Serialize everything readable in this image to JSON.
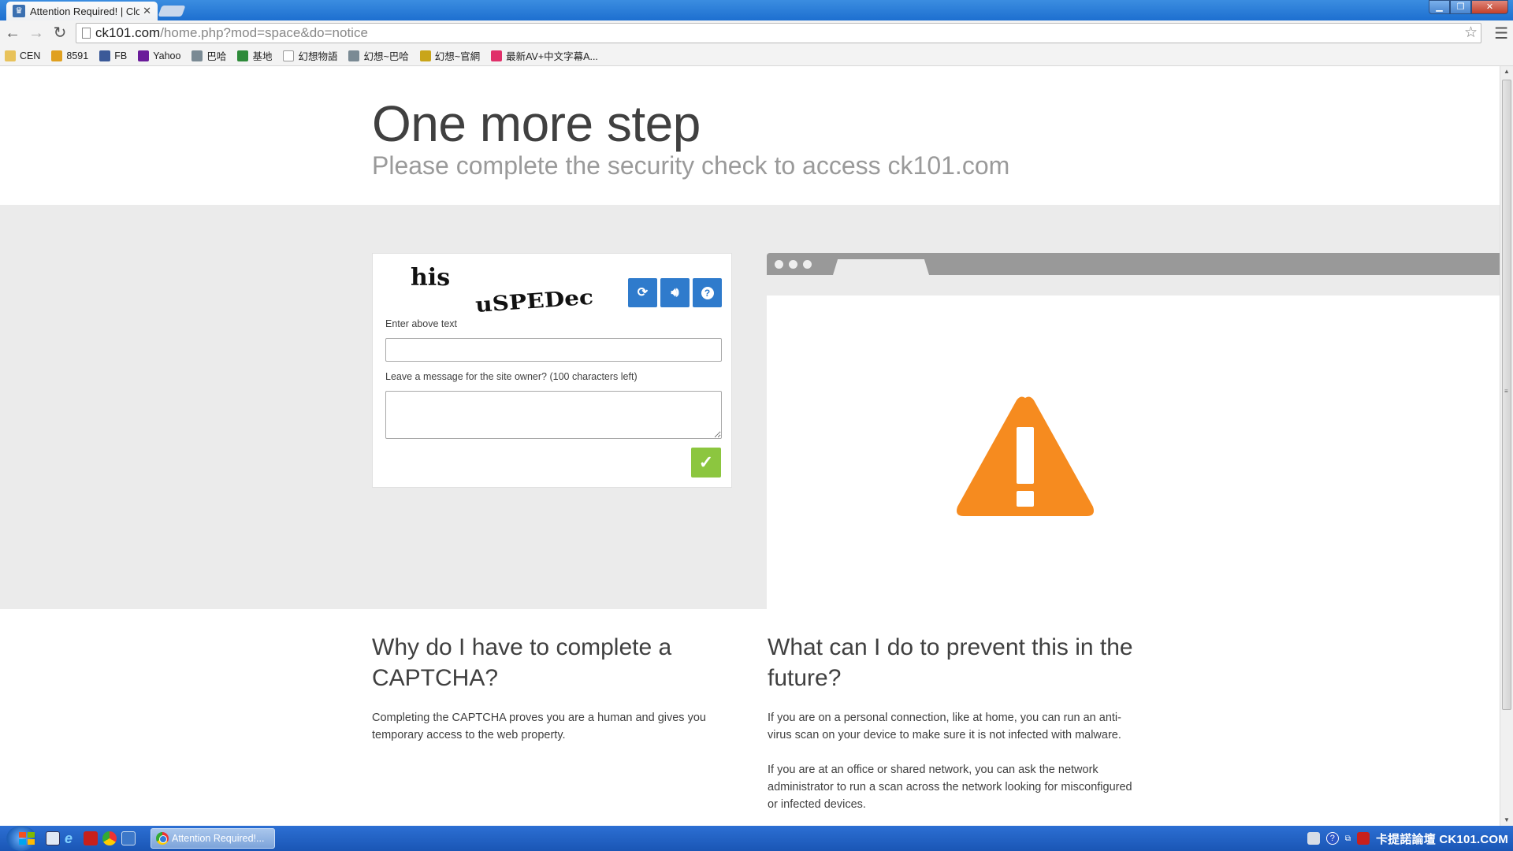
{
  "browser": {
    "tab_title": "Attention Required! | Cloudflare",
    "url_host": "ck101.com",
    "url_path": "/home.php?mod=space&do=notice",
    "bookmarks": [
      {
        "label": "CEN",
        "icon": "folder-icon",
        "color": "#e8c25a"
      },
      {
        "label": "8591",
        "icon": "money-bag-icon",
        "color": "#e0a020"
      },
      {
        "label": "FB",
        "icon": "facebook-icon",
        "color": "#3b5998"
      },
      {
        "label": "Yahoo",
        "icon": "yahoo-icon",
        "color": "#6a1b9a"
      },
      {
        "label": "巴哈",
        "icon": "dragon-icon",
        "color": "#7a8a94"
      },
      {
        "label": "基地",
        "icon": "clover-icon",
        "color": "#2e8b3a"
      },
      {
        "label": "幻想物語",
        "icon": "page-icon",
        "color": "#ffffff"
      },
      {
        "label": "幻想~巴哈",
        "icon": "dragon-icon",
        "color": "#7a8a94"
      },
      {
        "label": "幻想~官網",
        "icon": "game-icon",
        "color": "#c9a51a"
      },
      {
        "label": "最新AV+中文字幕A...",
        "icon": "lips-icon",
        "color": "#e0306a"
      }
    ]
  },
  "page": {
    "title": "One more step",
    "subtitle": "Please complete the security check to access ck101.com",
    "captcha": {
      "word1": "his",
      "word2": "uSPEDec",
      "refresh_icon": "refresh-icon",
      "audio_icon": "audio-icon",
      "help_icon": "help-icon",
      "enter_label": "Enter above text",
      "enter_value": "",
      "message_label": "Leave a message for the site owner? (100 characters left)",
      "message_value": "",
      "submit_icon": "checkmark-icon"
    },
    "colors": {
      "button_blue": "#2f7bcc",
      "submit_green": "#8cc63f",
      "warning_orange": "#f68b1f"
    },
    "why": {
      "heading": "Why do I have to complete a CAPTCHA?",
      "body": "Completing the CAPTCHA proves you are a human and gives you temporary access to the web property."
    },
    "prevent": {
      "heading": "What can I do to prevent this in the future?",
      "body1": "If you are on a personal connection, like at home, you can run an anti-virus scan on your device to make sure it is not infected with malware.",
      "body2": "If you are at an office or shared network, you can ask the network administrator to run a scan across the network looking for misconfigured or infected devices."
    }
  },
  "taskbar": {
    "active_app": "Attention Required!...",
    "tray_text": "卡提諾論壇 CK101.COM"
  }
}
